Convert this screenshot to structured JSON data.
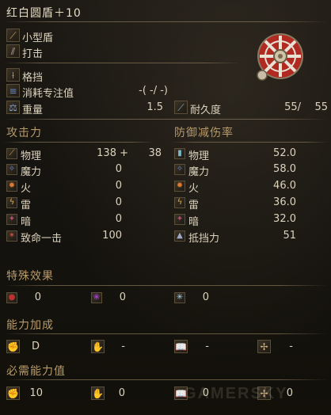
{
  "title": "红白圆盾＋10",
  "weapon_type": "小型盾",
  "attack_type": "打击",
  "skill": "格挡",
  "fp_cost": {
    "label": "消耗专注值",
    "value": "-(  -/  -)"
  },
  "weight": {
    "label": "重量",
    "value": "1.5"
  },
  "durability": {
    "label": "耐久度",
    "current": "55/",
    "max": "55"
  },
  "attack": {
    "heading": "攻击力",
    "rows": [
      {
        "label": "物理",
        "value": "138 +",
        "bonus": "38",
        "icon": "sword-icon"
      },
      {
        "label": "魔力",
        "value": "0",
        "icon": "magic-icon"
      },
      {
        "label": "火",
        "value": "0",
        "icon": "fire-icon"
      },
      {
        "label": "雷",
        "value": "0",
        "icon": "lightning-icon"
      },
      {
        "label": "暗",
        "value": "0",
        "icon": "dark-icon"
      },
      {
        "label": "致命一击",
        "value": "100",
        "icon": "critical-icon"
      }
    ]
  },
  "defense": {
    "heading": "防御减伤率",
    "rows": [
      {
        "label": "物理",
        "value": "52.0",
        "icon": "shield-physical-icon"
      },
      {
        "label": "魔力",
        "value": "58.0",
        "icon": "shield-magic-icon"
      },
      {
        "label": "火",
        "value": "46.0",
        "icon": "shield-fire-icon"
      },
      {
        "label": "雷",
        "value": "36.0",
        "icon": "shield-lightning-icon"
      },
      {
        "label": "暗",
        "value": "32.0",
        "icon": "shield-dark-icon"
      },
      {
        "label": "抵挡力",
        "value": "51",
        "icon": "stability-icon"
      }
    ]
  },
  "special_effects": {
    "heading": "特殊效果",
    "items": [
      {
        "icon": "bleed-icon",
        "value": "0"
      },
      {
        "icon": "poison-icon",
        "value": "0"
      },
      {
        "icon": "frost-icon",
        "value": "0"
      }
    ]
  },
  "scaling": {
    "heading": "能力加成",
    "items": [
      {
        "icon": "strength-icon",
        "value": "D"
      },
      {
        "icon": "dexterity-icon",
        "value": "-"
      },
      {
        "icon": "intelligence-icon",
        "value": "-"
      },
      {
        "icon": "faith-icon",
        "value": "-"
      }
    ]
  },
  "requirements": {
    "heading": "必需能力值",
    "items": [
      {
        "icon": "strength-req-icon",
        "value": "10"
      },
      {
        "icon": "dexterity-req-icon",
        "value": "0"
      },
      {
        "icon": "intelligence-req-icon",
        "value": "0"
      },
      {
        "icon": "faith-req-icon",
        "value": "0"
      }
    ]
  },
  "watermark": "GAMERSKY",
  "colors": {
    "heading": "#b89a6a",
    "text": "#dcd3bd",
    "shield_red": "#b02a22",
    "shield_white": "#e8e2d4"
  }
}
